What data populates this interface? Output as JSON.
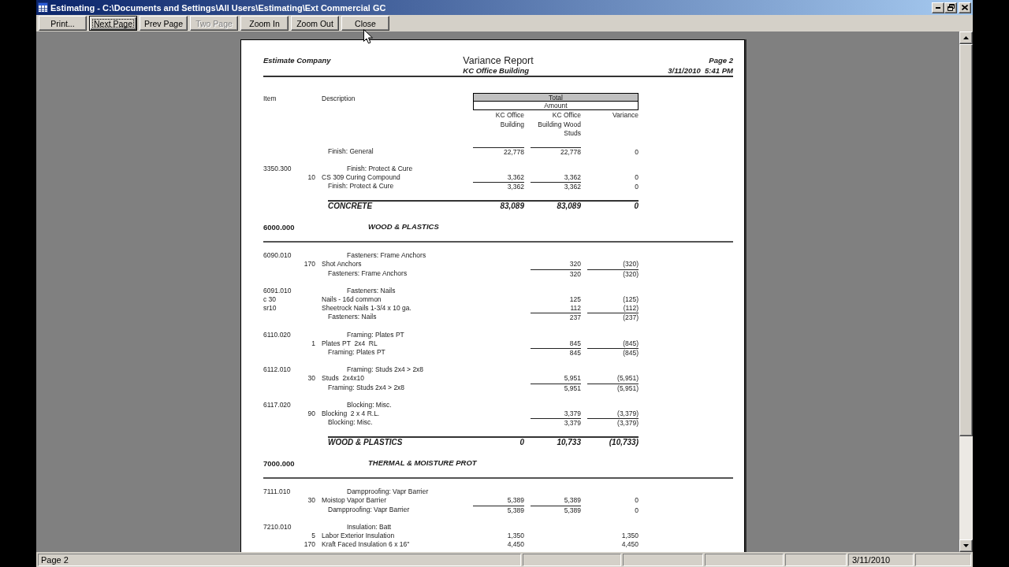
{
  "window": {
    "title": "Estimating - C:\\Documents and Settings\\All Users\\Estimating\\Ext Commercial GC"
  },
  "toolbar": [
    {
      "label": "Print...",
      "focused": false,
      "disabled": false
    },
    {
      "label": "Next Page",
      "focused": true,
      "disabled": false
    },
    {
      "label": "Prev Page",
      "focused": false,
      "disabled": false
    },
    {
      "label": "Two Page",
      "focused": false,
      "disabled": true
    },
    {
      "label": "Zoom In",
      "focused": false,
      "disabled": false
    },
    {
      "label": "Zoom Out",
      "focused": false,
      "disabled": false
    },
    {
      "label": "Close",
      "focused": false,
      "disabled": false
    }
  ],
  "report": {
    "company": "Estimate Company",
    "title": "Variance Report",
    "project": "KC Office Building",
    "page": "Page 2",
    "printed": "3/11/2010  5:41 PM",
    "columns": {
      "item": "Item",
      "description": "Description",
      "group_header": "Total",
      "group_subheader": "Amount",
      "building": "KC Office Building",
      "wood_studs": "KC Office Building Wood Studs",
      "variance": "Variance"
    },
    "rows": [
      {
        "kind": "subtotal",
        "description": "Finish: General",
        "building": {
          "value": "22,778",
          "rule_above": true
        },
        "wood_studs": {
          "value": "22,778",
          "rule_above": true
        },
        "variance": {
          "value": "0",
          "rule_above": false
        }
      },
      {
        "kind": "group",
        "item": "3350.300",
        "description": "Finish: Protect & Cure"
      },
      {
        "kind": "detail",
        "quantity": "10",
        "description": "CS 309 Curing Compound",
        "building": "3,362",
        "wood_studs": "3,362",
        "variance": "0"
      },
      {
        "kind": "subtotal",
        "description": "Finish: Protect & Cure",
        "building": {
          "value": "3,362",
          "rule_above": true
        },
        "wood_studs": {
          "value": "3,362",
          "rule_above": true
        },
        "variance": {
          "value": "0",
          "rule_above": false
        }
      },
      {
        "kind": "section_total",
        "description": "CONCRETE",
        "building": "83,089",
        "wood_studs": "83,089",
        "variance": "0"
      },
      {
        "kind": "section",
        "item": "6000.000",
        "description": "WOOD & PLASTICS"
      },
      {
        "kind": "group",
        "item": "6090.010",
        "description": "Fasteners: Frame Anchors"
      },
      {
        "kind": "detail",
        "quantity": "170",
        "description": "Shot Anchors",
        "wood_studs": "320",
        "variance": "(320)"
      },
      {
        "kind": "subtotal",
        "description": "Fasteners: Frame Anchors",
        "wood_studs": {
          "value": "320",
          "rule_above": true
        },
        "variance": {
          "value": "(320)",
          "rule_above": true
        }
      },
      {
        "kind": "group",
        "item": "6091.010",
        "description": "Fasteners: Nails"
      },
      {
        "kind": "detail",
        "item": "c 30",
        "description": "Nails - 16d common",
        "wood_studs": "125",
        "variance": "(125)"
      },
      {
        "kind": "detail",
        "item": "sr10",
        "description": "Sheetrock Nails 1-3/4 x 10 ga.",
        "wood_studs": "112",
        "variance": "(112)"
      },
      {
        "kind": "subtotal",
        "description": "Fasteners: Nails",
        "wood_studs": {
          "value": "237",
          "rule_above": true
        },
        "variance": {
          "value": "(237)",
          "rule_above": true
        }
      },
      {
        "kind": "group",
        "item": "6110.020",
        "description": "Framing: Plates PT"
      },
      {
        "kind": "detail",
        "quantity": "1",
        "description": "Plates PT  2x4  RL",
        "wood_studs": "845",
        "variance": "(845)"
      },
      {
        "kind": "subtotal",
        "description": "Framing: Plates PT",
        "wood_studs": {
          "value": "845",
          "rule_above": true
        },
        "variance": {
          "value": "(845)",
          "rule_above": true
        }
      },
      {
        "kind": "group",
        "item": "6112.010",
        "description": "Framing: Studs 2x4 > 2x8"
      },
      {
        "kind": "detail",
        "quantity": "30",
        "description": "Studs  2x4x10",
        "wood_studs": "5,951",
        "variance": "(5,951)"
      },
      {
        "kind": "subtotal",
        "description": "Framing: Studs 2x4 > 2x8",
        "wood_studs": {
          "value": "5,951",
          "rule_above": true
        },
        "variance": {
          "value": "(5,951)",
          "rule_above": true
        }
      },
      {
        "kind": "group",
        "item": "6117.020",
        "description": "Blocking: Misc."
      },
      {
        "kind": "detail",
        "quantity": "90",
        "description": "Blocking  2 x 4 R.L.",
        "wood_studs": "3,379",
        "variance": "(3,379)"
      },
      {
        "kind": "subtotal",
        "description": "Blocking: Misc.",
        "wood_studs": {
          "value": "3,379",
          "rule_above": true
        },
        "variance": {
          "value": "(3,379)",
          "rule_above": true
        }
      },
      {
        "kind": "section_total",
        "description": "WOOD & PLASTICS",
        "building": "0",
        "wood_studs": "10,733",
        "variance": "(10,733)"
      },
      {
        "kind": "section",
        "item": "7000.000",
        "description": "THERMAL & MOISTURE PROT"
      },
      {
        "kind": "group",
        "item": "7111.010",
        "description": "Dampproofing: Vapr Barrier"
      },
      {
        "kind": "detail",
        "quantity": "30",
        "description": "Moistop Vapor Barrier",
        "building": "5,389",
        "wood_studs": "5,389",
        "variance": "0"
      },
      {
        "kind": "subtotal",
        "description": "Dampproofing: Vapr Barrier",
        "building": {
          "value": "5,389",
          "rule_above": true
        },
        "wood_studs": {
          "value": "5,389",
          "rule_above": true
        },
        "variance": {
          "value": "0",
          "rule_above": false
        }
      },
      {
        "kind": "group",
        "item": "7210.010",
        "description": "Insulation: Batt"
      },
      {
        "kind": "detail",
        "quantity": "5",
        "description": "Labor Exterior Insulation",
        "building": "1,350",
        "variance": "1,350"
      },
      {
        "kind": "detail",
        "quantity": "170",
        "description": "Kraft Faced Insulation 6 x 16\"",
        "building": "4,450",
        "variance": "4,450"
      }
    ]
  },
  "status_bar": {
    "page": "Page 2",
    "date": "3/11/2010"
  }
}
